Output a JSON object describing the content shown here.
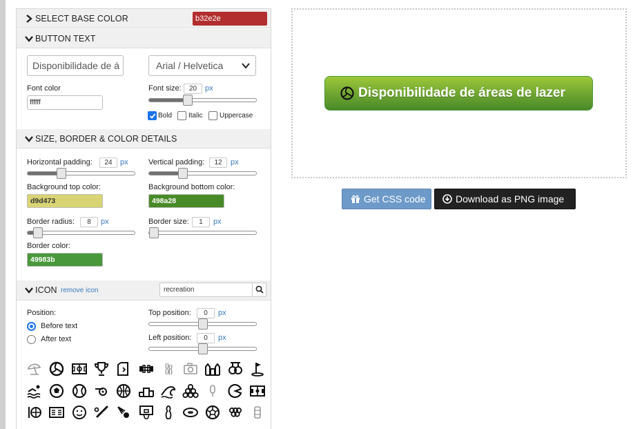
{
  "sections": {
    "base_color": {
      "title": "SELECT BASE COLOR",
      "value": "b32e2e",
      "color": "#b32e2e"
    },
    "button_text": {
      "title": "BUTTON TEXT",
      "text_value": "Disponibilidade de á",
      "font_family": "Arial / Helvetica",
      "font_color_label": "Font color",
      "font_color_value": "ffffff",
      "font_size_label": "Font size:",
      "font_size_value": "20",
      "unit": "px",
      "font_size_level": 0.35,
      "bold_label": "Bold",
      "bold_checked": true,
      "italic_label": "Italic",
      "italic_checked": false,
      "uppercase_label": "Uppercase",
      "uppercase_checked": false
    },
    "size_border": {
      "title": "SIZE, BORDER & COLOR DETAILS",
      "h_padding_label": "Horizontal padding:",
      "h_padding_value": "24",
      "h_padding_level": 0.3,
      "v_padding_label": "Vertical padding:",
      "v_padding_value": "12",
      "v_padding_level": 0.3,
      "bg_top_label": "Background top color:",
      "bg_top_value": "d9d473",
      "bg_top_color": "#d9d473",
      "bg_bottom_label": "Background bottom color:",
      "bg_bottom_value": "498a28",
      "bg_bottom_color": "#498a28",
      "radius_label": "Border radius:",
      "radius_value": "8",
      "radius_level": 0.06,
      "border_size_label": "Border size:",
      "border_size_value": "1",
      "border_size_level": 0.0,
      "border_color_label": "Border color:",
      "border_color_value": "49983b",
      "border_color_color": "#49983b",
      "unit": "px"
    },
    "icon": {
      "title": "ICON",
      "remove_label": "remove icon",
      "search_value": "recreation",
      "position_label": "Position:",
      "before_label": "Before text",
      "before_selected": true,
      "after_label": "After text",
      "after_selected": false,
      "top_pos_label": "Top position:",
      "top_pos_value": "0",
      "top_pos_level": 0.5,
      "left_pos_label": "Left position:",
      "left_pos_value": "0",
      "left_pos_level": 0.5,
      "unit": "px",
      "grid_icons": [
        "beach-umbrella-icon",
        "volleyball-icon",
        "soccer-field-icon",
        "trophy-icon",
        "exit-door-icon",
        "dumbbell-icon",
        "bowling-pins-icon",
        "camera-icon",
        "castle-icon",
        "rings-icon",
        "golf-flag-icon",
        "swimming-icon",
        "soccer-ball-icon",
        "tennis-ball-icon",
        "whistle-icon",
        "basketball-icon",
        "podium-icon",
        "wave-icon",
        "billiard-balls-icon",
        "ice-cream-icon",
        "pacman-icon",
        "field-icon",
        "globe-pin-icon",
        "scoreboard-icon",
        "smiley-ball-icon",
        "baseball-bat-icon",
        "shuttlecock-icon",
        "basketball-hoop-icon",
        "bowling-pin-icon",
        "football-icon",
        "soccer-ball-2-icon",
        "grapes-icon",
        "can-icon"
      ]
    }
  },
  "preview": {
    "button_text": "Disponibilidade de áreas de lazer",
    "icon": "volleyball-icon",
    "top_color": "#9ec83a",
    "bottom_color": "#498a28",
    "border_color": "#49983b"
  },
  "actions": {
    "css_label": "Get CSS code",
    "png_label": "Download as PNG image"
  }
}
